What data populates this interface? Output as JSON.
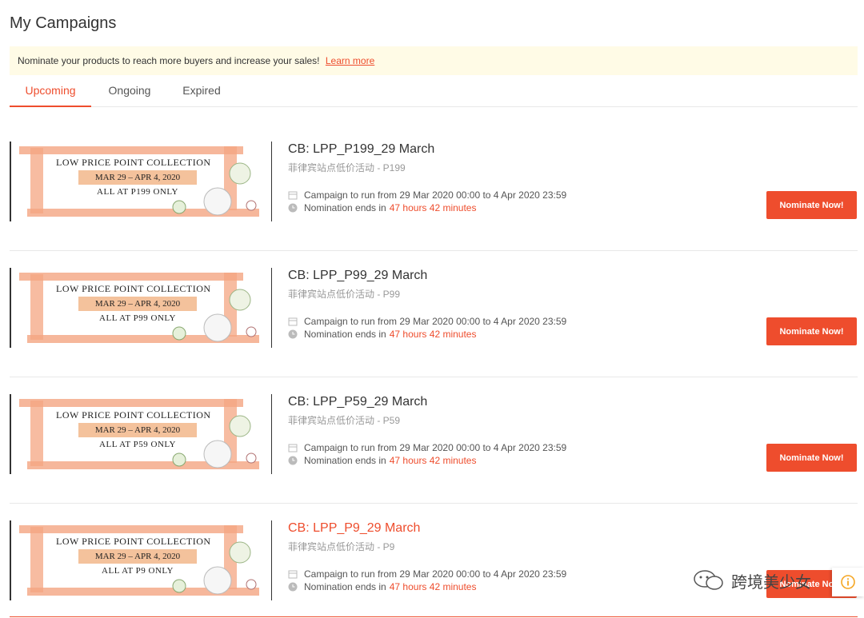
{
  "page": {
    "title": "My Campaigns"
  },
  "notice": {
    "text": "Nominate your products to reach more buyers and increase your sales!",
    "link": "Learn more"
  },
  "tabs": [
    {
      "label": "Upcoming",
      "active": true
    },
    {
      "label": "Ongoing",
      "active": false
    },
    {
      "label": "Expired",
      "active": false
    }
  ],
  "campaigns": [
    {
      "title": "CB: LPP_P199_29 March",
      "subtitle": "菲律宾站点低价活动 - P199",
      "banner": {
        "title": "LOW PRICE POINT COLLECTION",
        "dates": "MAR 29 – APR 4, 2020",
        "price": "ALL AT P199 ONLY"
      },
      "run_label": "Campaign to run from 29 Mar 2020 00:00 to 4 Apr 2020 23:59",
      "ends_label": "Nomination ends in",
      "ends_value": "47 hours 42 minutes",
      "button": "Nominate Now!"
    },
    {
      "title": "CB: LPP_P99_29 March",
      "subtitle": "菲律宾站点低价活动 - P99",
      "banner": {
        "title": "LOW PRICE POINT COLLECTION",
        "dates": "MAR 29 – APR 4, 2020",
        "price": "ALL AT P99 ONLY"
      },
      "run_label": "Campaign to run from 29 Mar 2020 00:00 to 4 Apr 2020 23:59",
      "ends_label": "Nomination ends in",
      "ends_value": "47 hours 42 minutes",
      "button": "Nominate Now!"
    },
    {
      "title": "CB: LPP_P59_29 March",
      "subtitle": "菲律宾站点低价活动 - P59",
      "banner": {
        "title": "LOW PRICE POINT COLLECTION",
        "dates": "MAR 29 – APR 4, 2020",
        "price": "ALL AT P59 ONLY"
      },
      "run_label": "Campaign to run from 29 Mar 2020 00:00 to 4 Apr 2020 23:59",
      "ends_label": "Nomination ends in",
      "ends_value": "47 hours 42 minutes",
      "button": "Nominate Now!"
    },
    {
      "title": "CB: LPP_P9_29 March",
      "subtitle": "菲律宾站点低价活动 - P9",
      "banner": {
        "title": "LOW PRICE POINT COLLECTION",
        "dates": "MAR 29 – APR 4, 2020",
        "price": "ALL AT P9 ONLY"
      },
      "run_label": "Campaign to run from 29 Mar 2020 00:00 to 4 Apr 2020 23:59",
      "ends_label": "Nomination ends in",
      "ends_value": "47 hours 42 minutes",
      "button": "Nominate Now!"
    }
  ],
  "watermark": {
    "text": "跨境美少女"
  },
  "icons": {
    "calendar": "calendar-icon",
    "clock": "clock-icon",
    "wechat": "wechat-icon",
    "help": "info-icon"
  },
  "colors": {
    "accent": "#ee4d2d",
    "notice_bg": "#fffbe6"
  }
}
